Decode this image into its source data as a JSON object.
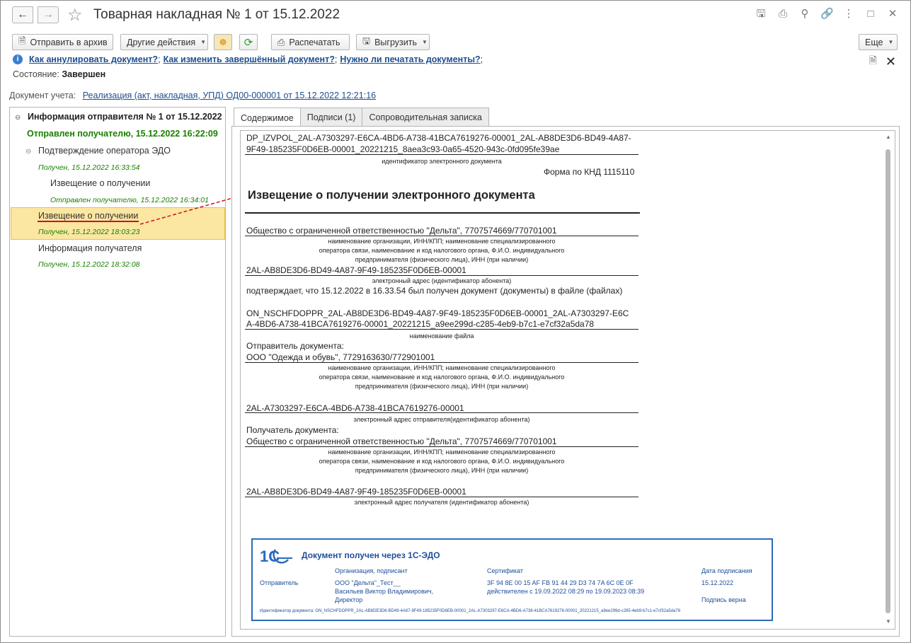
{
  "window": {
    "title": "Товарная накладная № 1 от 15.12.2022"
  },
  "toolbar": {
    "archive": "Отправить в архив",
    "other_actions": "Другие действия",
    "print": "Распечатать",
    "export": "Выгрузить",
    "more": "Еще"
  },
  "help_links": {
    "link1": "Как аннулировать документ?",
    "link2": "Как изменить завершённый документ?",
    "link3": "Нужно ли печатать документы?",
    "sep": ";"
  },
  "state": {
    "label": "Состояние:",
    "value": "Завершен"
  },
  "accounting_doc": {
    "label": "Документ учета:",
    "link": "Реализация (акт, накладная, УПД) ОД00-000001 от 15.12.2022 12:21:16"
  },
  "tree": [
    {
      "text": "Информация отправителя № 1 от 15.12.2022"
    },
    {
      "text": "Отправлен получателю, 15.12.2022 16:22:09"
    },
    {
      "text": "Подтверждение оператора ЭДО"
    },
    {
      "text": "Получен, 15.12.2022 16:33:54"
    },
    {
      "text": "Извещение о получении"
    },
    {
      "text": "Отправлен получателю, 15.12.2022 16:34:01"
    },
    {
      "text": "Извещение о получении"
    },
    {
      "text": "Получен, 15.12.2022 18:03:23"
    },
    {
      "text": "Информация получателя"
    },
    {
      "text": "Получен, 15.12.2022 18:32:08"
    }
  ],
  "tabs": [
    "Содержимое",
    "Подписи (1)",
    "Сопроводительная записка"
  ],
  "document": {
    "id_line1": "DP_IZVPOL_2AL-A7303297-E6CA-4BD6-A738-41BCA7619276-00001_2AL-AB8DE3D6-BD49-4A87-",
    "id_line2": "9F49-185235F0D6EB-00001_20221215_8aea3c93-0a65-4520-943c-0fd095fe39ae",
    "id_caption": "идентификатор электронного документа",
    "form": "Форма по КНД 1115110",
    "title": "Извещение о получении электронного документа",
    "org1": "Общество с ограниченной ответственностью \"Дельта\", 7707574669/770701001",
    "org_caption1": "наименование организации, ИНН/КПП; наименование специализированного",
    "org_caption2": "оператора связи, наименование и код налогового органа, Ф.И.О. индивидуального",
    "org_caption3": "предпринимателя (физического лица), ИНН (при наличии)",
    "addr1": "2AL-AB8DE3D6-BD49-4A87-9F49-185235F0D6EB-00001",
    "addr_caption": "электронный адрес (идентификатор абонента)",
    "confirm": "подтверждает, что 15.12.2022 в 16.33.54 был получен документ (документы) в файле (файлах)",
    "file1": "ON_NSCHFDOPPR_2AL-AB8DE3D6-BD49-4A87-9F49-185235F0D6EB-00001_2AL-A7303297-E6C",
    "file2": "A-4BD6-A738-41BCA7619276-00001_20221215_a9ee299d-c285-4eb9-b7c1-e7cf32a5da78",
    "file_caption": "наименование файла",
    "sender_label": "Отправитель документа:",
    "sender": "ООО \"Одежда и обувь\", 7729163630/772901001",
    "sender_addr": "2AL-A7303297-E6CA-4BD6-A738-41BCA7619276-00001",
    "sender_addr_caption": "электронный адрес отправителя(идентификатор абонента)",
    "recipient_label": "Получатель документа:",
    "recipient": "Общество с ограниченной ответственностью \"Дельта\", 7707574669/770701001",
    "recipient_addr": "2AL-AB8DE3D6-BD49-4A87-9F49-185235F0D6EB-00001",
    "recipient_addr_caption": "электронный адрес получателя (идентификатор абонента)"
  },
  "stamp": {
    "title": "Документ получен через 1С-ЭДО",
    "col_org": "Организация, подписант",
    "col_cert": "Сертификат",
    "col_date": "Дата подписания",
    "role": "Отправитель",
    "org": "ООО \"Дельта\"_Тест__",
    "signer": "Васильев Виктор Владимирович,",
    "position": "Директор",
    "cert": "3F 94 8E 00 15 AF FB 91 44 29 D3 74 7A 6C 0E 0F",
    "valid": "действителен с 19.09.2022 08:29 по 19.09.2023 08:39",
    "date": "15.12.2022",
    "sig_ok": "Подпись верна",
    "doc_id": "Идентификатор документа: ON_NSCHFDOPPR_2AL-AB8DE3D6-BD49-4A87-9F49-185235F0D6EB-00001_2AL-A7303297-E6CA-4BD6-A738-41BCA7619276-00001_20221215_a9ee299d-c285-4eb9-b7c1-e7cf32a5da78",
    "logo_text": "1С"
  },
  "colors": {
    "link": "#1e4f8f",
    "green_status": "#1a7f00",
    "selection": "#fbe6a2",
    "annotation_red": "#d0121b",
    "stamp_blue": "#2b6bbd"
  }
}
